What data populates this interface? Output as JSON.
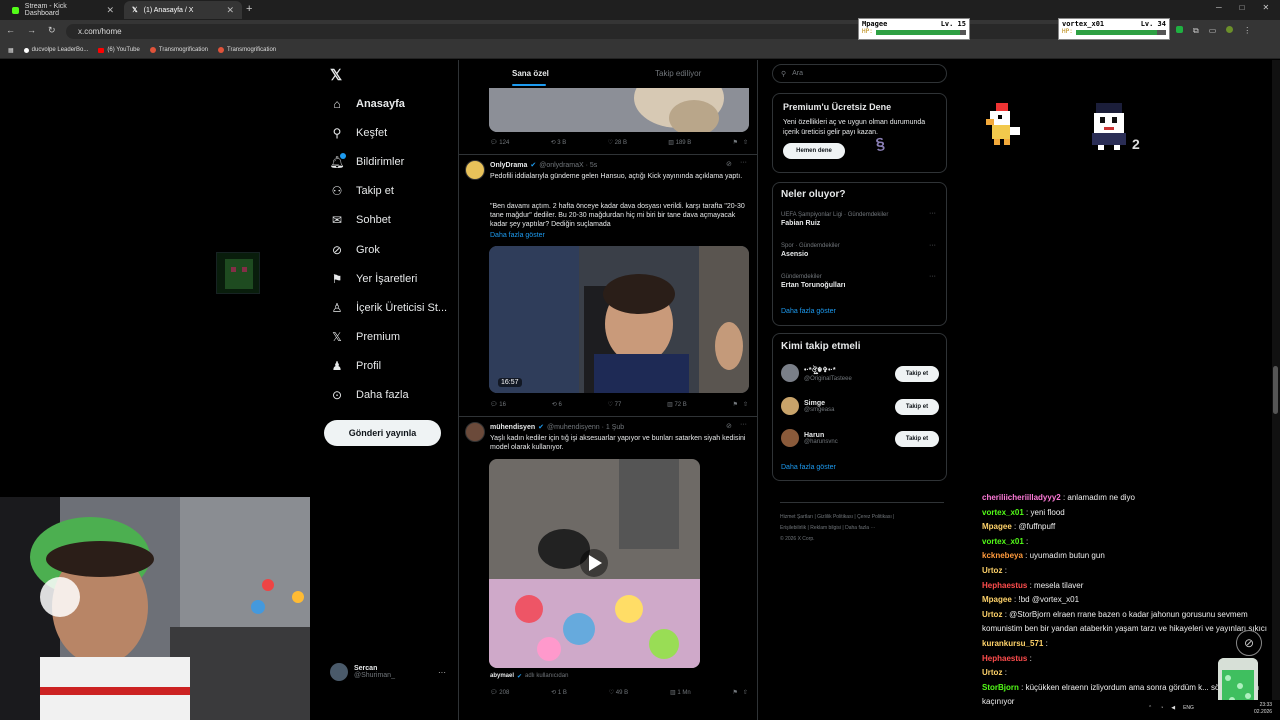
{
  "browser": {
    "tabs": [
      {
        "title": "Stream - Kick Dashboard",
        "active": false
      },
      {
        "title": "(1) Anasayfa / X",
        "active": true
      }
    ],
    "url": "x.com/home",
    "bookmarks": [
      "ducvolpe LeaderBo...",
      "(6) YouTube",
      "Transmogrification",
      "Transmogrification"
    ]
  },
  "overlay": {
    "players": [
      {
        "name": "Mpagee",
        "level": "Lv. 15",
        "hp_label": "HP:",
        "hp_fill": 0.93
      },
      {
        "name": "vortex_x01",
        "level": "Lv. 34",
        "hp_label": "HP:",
        "hp_fill": 0.9
      }
    ],
    "sprite_count": "2"
  },
  "sidebar": {
    "items": [
      {
        "label": "Anasayfa",
        "icon": "home-icon",
        "bold": true
      },
      {
        "label": "Keşfet",
        "icon": "search-icon"
      },
      {
        "label": "Bildirimler",
        "icon": "bell-icon"
      },
      {
        "label": "Takip et",
        "icon": "follow-icon"
      },
      {
        "label": "Sohbet",
        "icon": "mail-icon"
      },
      {
        "label": "Grok",
        "icon": "grok-icon"
      },
      {
        "label": "Yer İşaretleri",
        "icon": "bookmark-icon"
      },
      {
        "label": "İçerik Üreticisi St...",
        "icon": "creator-icon"
      },
      {
        "label": "Premium",
        "icon": "x-icon"
      },
      {
        "label": "Profil",
        "icon": "profile-icon"
      },
      {
        "label": "Daha fazla",
        "icon": "more-icon"
      }
    ],
    "post_button": "Gönderi yayınla",
    "account": {
      "name": "Sercan",
      "handle": "@Shuriman_",
      "more": "···"
    }
  },
  "feed": {
    "tabs": [
      "Sana özel",
      "Takip ediliyor"
    ],
    "tweet0_actions": [
      "124",
      "3 B",
      "28 B",
      "189 B"
    ],
    "tweets": [
      {
        "name": "OnlyDrama",
        "handle": "@onlydramaX · 5s",
        "text1": "Pedofili iddialarıyla gündeme gelen Hansuo, açtığı Kick yayınında açıklama yaptı.",
        "text2": "\"Ben davamı açtım. 2 hafta önceye kadar dava dosyası verildi. karşı tarafta \"20-30 tane mağdur\" dediler. Bu 20-30 mağdurdan hiç mi biri bir tane dava açmayacak kadar şey yaptılar? Dediğin suçlamada",
        "more": "Daha fazla göster",
        "video_time": "16:57",
        "actions": [
          "16",
          "6",
          "77",
          "72 B"
        ]
      },
      {
        "name": "mühendisyen",
        "handle": "@muhendisyenn · 1 Şub",
        "text1": "Yaşlı kadın kediler için tığ işi aksesuarlar yapıyor ve bunları satarken siyah kedisini model olarak kullanıyor.",
        "credit_user": "abymael",
        "credit_text": "adlı kullanıcıdan",
        "actions": [
          "208",
          "1 B",
          "49 B",
          "1 Mn"
        ]
      }
    ]
  },
  "right": {
    "search_placeholder": "Ara",
    "premium": {
      "title": "Premium'u Ücretsiz Dene",
      "text": "Yeni özellikleri aç ve uygun olman durumunda içerik üreticisi gelir payı kazan.",
      "button": "Hemen dene"
    },
    "trends": {
      "title": "Neler oluyor?",
      "items": [
        {
          "context": "UEFA Şampiyonlar Ligi · Gündemdekiler",
          "name": "Fabian Ruiz"
        },
        {
          "context": "Spor · Gündemdekiler",
          "name": "Asensio"
        },
        {
          "context": "Gündemdekiler",
          "name": "Ertan Torunoğulları"
        }
      ],
      "more": "Daha fazla göster"
    },
    "who_to_follow": {
      "title": "Kimi takip etmeli",
      "items": [
        {
          "name": "•·*ঔৣ☬✞•·*",
          "handle": "@OriginalTasteee",
          "button": "Takip et"
        },
        {
          "name": "Simge",
          "handle": "@smgeasa",
          "button": "Takip et"
        },
        {
          "name": "Harun",
          "handle": "@harunsvnc",
          "button": "Takip et"
        }
      ],
      "more": "Daha fazla göster"
    },
    "footer": [
      "Hizmet Şartları",
      "Gizlilik Politikası",
      "Çerez Politikası",
      "Erişilebilirlik",
      "Reklam bilgisi",
      "Daha fazla ···",
      "© 2026 X Corp."
    ]
  },
  "chat": {
    "messages": [
      {
        "user": "cheriliicheriilladyyy2",
        "color": "#ff7ad9",
        "text": ": anlamadım ne diyo"
      },
      {
        "user": "vortex_x01",
        "color": "#53fc18",
        "text": ": yeni flood"
      },
      {
        "user": "Mpagee",
        "color": "#ffd36a",
        "text": ": @fuffnpuff"
      },
      {
        "user": "vortex_x01",
        "color": "#53fc18",
        "text": ":"
      },
      {
        "user": "kcknebeya",
        "color": "#ff9a3c",
        "text": ": uyumadım butun gun"
      },
      {
        "user": "Urtoz",
        "color": "#ffd36a",
        "text": ":"
      },
      {
        "user": "Hephaestus",
        "color": "#ff4d4d",
        "text": ": mesela tilaver"
      },
      {
        "user": "Mpagee",
        "color": "#ffd36a",
        "text": ": !bd @vortex_x01"
      },
      {
        "user": "Urtoz",
        "color": "#ffd36a",
        "text": ": @StorBjorn elraen rrane bazen o kadar jahonun gorusunu sevmem komunistim ben bir yandan ataberkin yaşam tarzı ve hikayeleri ve yayınları sıkıcı"
      },
      {
        "user": "kurankursu_571",
        "color": "#ffd36a",
        "text": ":"
      },
      {
        "user": "Hephaestus",
        "color": "#ff4d4d",
        "text": ":"
      },
      {
        "user": "Urtoz",
        "color": "#ffd36a",
        "text": ":"
      },
      {
        "user": "StorBjorn",
        "color": "#53fc18",
        "text": ": küçükken elraenn izliyordum ama sonra gördüm k... söylemek için kaçınıyor"
      }
    ]
  },
  "taskbar": {
    "lang": "ENG",
    "time": "23:33",
    "date": "02.2026"
  }
}
